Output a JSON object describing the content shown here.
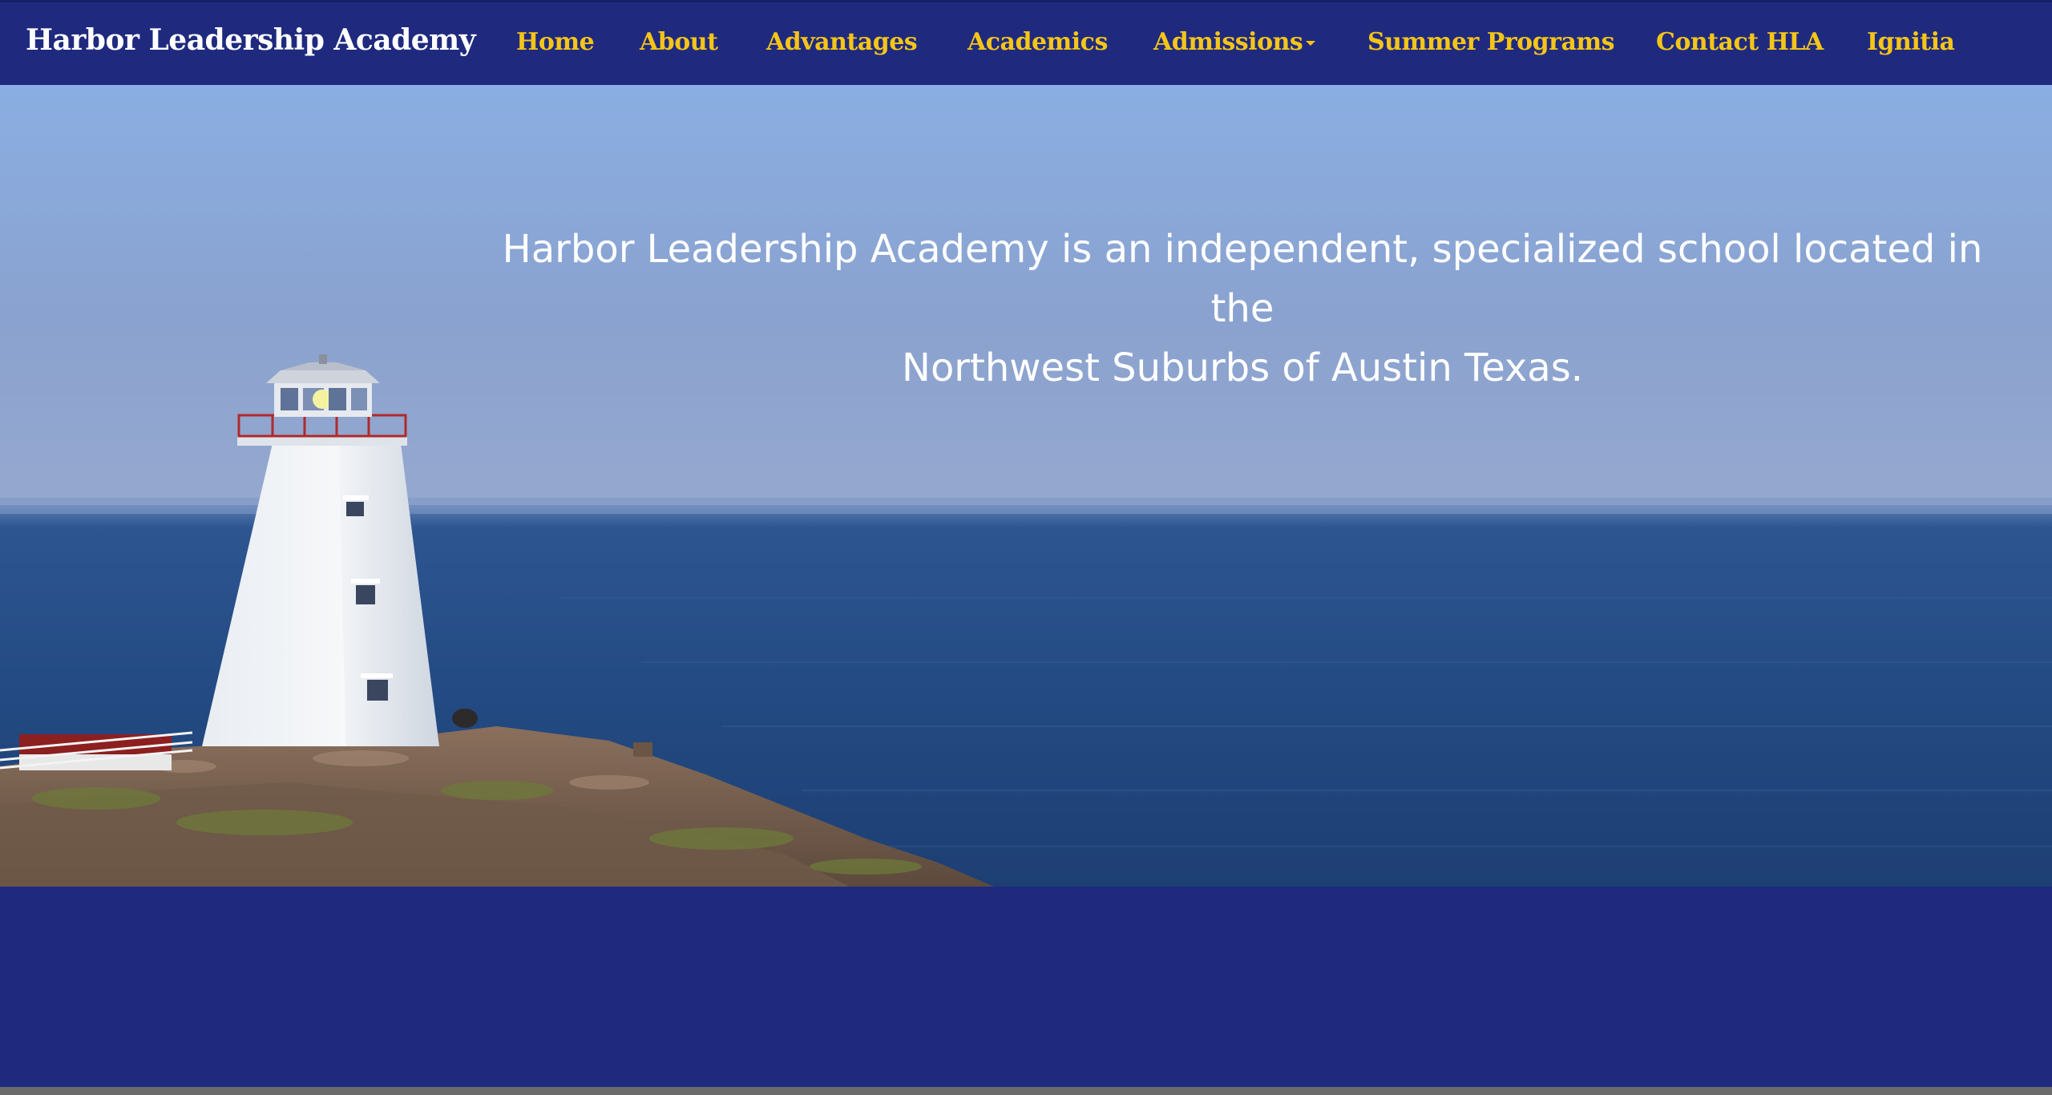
{
  "brand": {
    "name": "Harbor Leadership Academy"
  },
  "nav": {
    "items": [
      {
        "label": "Home"
      },
      {
        "label": "About"
      },
      {
        "label": "Advantages"
      },
      {
        "label": "Academics"
      },
      {
        "label": "Admissions",
        "has_dropdown": true
      },
      {
        "label": "Summer Programs"
      },
      {
        "label": "Contact HLA"
      },
      {
        "label": "Ignitia"
      }
    ]
  },
  "hero": {
    "tagline_line1": "Harbor Leadership Academy is an independent, specialized school located in the",
    "tagline_line2": "Northwest Suburbs of Austin Texas.",
    "image": "lighthouse-on-rocky-coast-over-ocean"
  },
  "colors": {
    "nav_background": "#1f2a7e",
    "nav_link": "#f5c518",
    "brand_text": "#ffffff",
    "tagline_text": "#ffffff"
  }
}
